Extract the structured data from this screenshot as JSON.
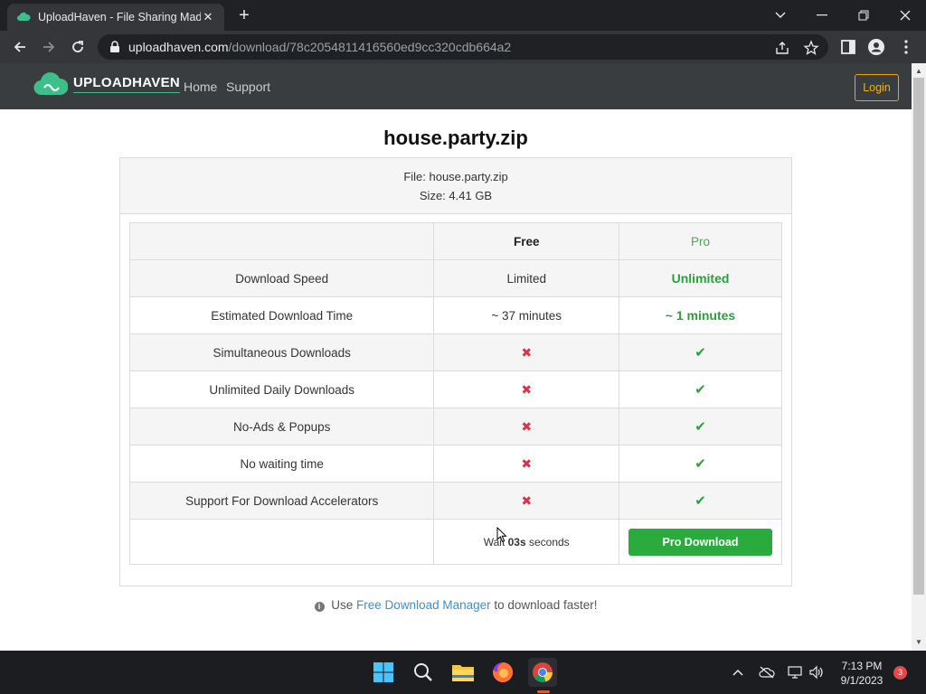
{
  "browser": {
    "tab_title": "UploadHaven - File Sharing Made",
    "url_host": "uploadhaven.com",
    "url_path": "/download/78c2054811416560ed9cc320cdb664a2"
  },
  "site": {
    "logo_text": "UPLOADHAVEN",
    "nav": [
      "Home",
      "Support"
    ],
    "login_label": "Login"
  },
  "file": {
    "heading": "house.party.zip",
    "file_line": "File: house.party.zip",
    "size_line": "Size: 4.41 GB"
  },
  "comparison": {
    "headers": {
      "feature": "",
      "free": "Free",
      "pro": "Pro"
    },
    "rows": [
      {
        "feature": "Download Speed",
        "free": "Limited",
        "pro": "Unlimited"
      },
      {
        "feature": "Estimated Download Time",
        "free": "~ 37 minutes",
        "pro": "~ 1 minutes"
      },
      {
        "feature": "Simultaneous Downloads",
        "free": "✖",
        "pro": "✔"
      },
      {
        "feature": "Unlimited Daily Downloads",
        "free": "✖",
        "pro": "✔"
      },
      {
        "feature": "No-Ads & Popups",
        "free": "✖",
        "pro": "✔"
      },
      {
        "feature": "No waiting time",
        "free": "✖",
        "pro": "✔"
      },
      {
        "feature": "Support For Download Accelerators",
        "free": "✖",
        "pro": "✔"
      }
    ],
    "wait_prefix": "Wait ",
    "wait_count": "03s",
    "wait_suffix": " seconds",
    "pro_download_label": "Pro Download"
  },
  "tip": {
    "prefix": " Use ",
    "link": "Free Download Manager",
    "suffix": " to download faster!"
  },
  "taskbar": {
    "time": "7:13 PM",
    "date": "9/1/2023",
    "notification_count": "3"
  },
  "colors": {
    "pro_green": "#2c9e3c",
    "cross_red": "#d9334b",
    "login_accent": "#f0a500",
    "link_blue": "#3e8fc9"
  }
}
